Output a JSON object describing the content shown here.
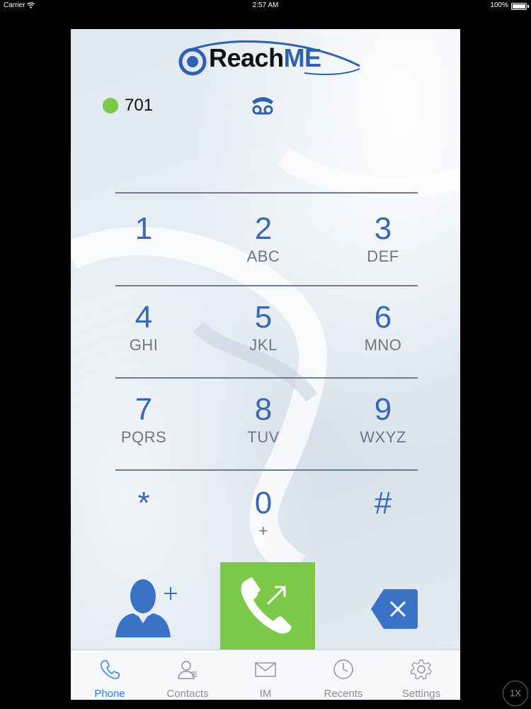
{
  "status_bar": {
    "carrier": "Carrier",
    "time": "2:57 AM",
    "battery": "100%"
  },
  "app": {
    "logo": {
      "reach": "Reach",
      "me": "ME"
    },
    "extension": "701",
    "status_color": "#7cc94a",
    "accent_color": "#3a68b5"
  },
  "keypad": {
    "keys": [
      {
        "digit": "1",
        "letters": ""
      },
      {
        "digit": "2",
        "letters": "ABC"
      },
      {
        "digit": "3",
        "letters": "DEF"
      },
      {
        "digit": "4",
        "letters": "GHI"
      },
      {
        "digit": "5",
        "letters": "JKL"
      },
      {
        "digit": "6",
        "letters": "MNO"
      },
      {
        "digit": "7",
        "letters": "PQRS"
      },
      {
        "digit": "8",
        "letters": "TUV"
      },
      {
        "digit": "9",
        "letters": "WXYZ"
      },
      {
        "digit": "*",
        "letters": ""
      },
      {
        "digit": "0",
        "letters": "+"
      },
      {
        "digit": "#",
        "letters": ""
      }
    ]
  },
  "actions": {
    "add_contact_icon": "add-contact-icon",
    "call_icon": "outgoing-call-icon",
    "backspace_icon": "backspace-icon",
    "call_color": "#7cc94a"
  },
  "tabs": [
    {
      "label": "Phone",
      "icon": "phone-icon",
      "active": true
    },
    {
      "label": "Contacts",
      "icon": "contacts-icon",
      "active": false
    },
    {
      "label": "IM",
      "icon": "envelope-icon",
      "active": false
    },
    {
      "label": "Recents",
      "icon": "clock-icon",
      "active": false
    },
    {
      "label": "Settings",
      "icon": "gear-icon",
      "active": false
    }
  ],
  "zoom_badge": "1X"
}
